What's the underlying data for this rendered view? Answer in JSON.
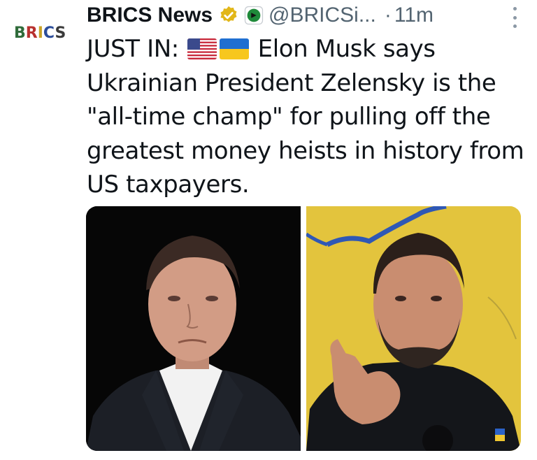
{
  "author": {
    "avatar_text": "BRICS",
    "name": "BRICS News",
    "handle": "@BRICSi...",
    "separator": "·",
    "time": "11m"
  },
  "icons": {
    "verified": "verified-badge-icon",
    "affiliate": "affiliate-logo-icon",
    "more": "more-options-icon"
  },
  "tweet": {
    "prefix": "JUST IN:",
    "flags": [
      "us-flag",
      "ukraine-flag"
    ],
    "body": "Elon Musk says Ukrainian President Zelensky is the \"all-time champ\" for pulling off the greatest money heists in history from US taxpayers."
  },
  "colors": {
    "text": "#0f1419",
    "secondary": "#536471",
    "verified_gold": "#e2b719"
  }
}
